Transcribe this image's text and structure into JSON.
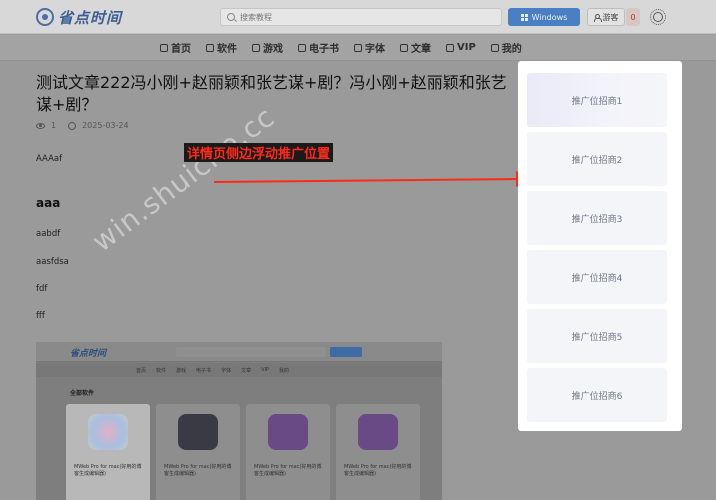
{
  "header": {
    "logo_text": "省点时间",
    "search_placeholder": "搜索教程",
    "windows_label": "Windows",
    "guest_label": "游客",
    "notification_count": "0"
  },
  "nav": {
    "items": [
      "首页",
      "软件",
      "游戏",
      "电子书",
      "字体",
      "文章",
      "VIP",
      "我的"
    ]
  },
  "article": {
    "title": "测试文章222冯小刚+赵丽颖和张艺谋+剧？冯小刚+赵丽颖和张艺谋+剧？",
    "views": "1",
    "date": "2025-03-24",
    "paragraphs": [
      "AAAaf",
      "aabdf",
      "aasfdsa",
      "fdf",
      "fff"
    ],
    "heading": "aaa"
  },
  "annotation": {
    "text": "详情页侧边浮动推广位置",
    "color": "#ff2a1a"
  },
  "watermark": "win.shuiche.cc",
  "embedded_screenshot": {
    "logo_text": "省点时间",
    "nav_items": [
      "首页",
      "软件",
      "游戏",
      "电子书",
      "字体",
      "文章",
      "VIP",
      "我的"
    ],
    "section_title": "全部软件",
    "cards": [
      "MWeb Pro for mac(好用的博客生成编辑器)",
      "MWeb Pro for mac(好用的博客生成编辑器)",
      "MWeb Pro for mac(好用的博客生成编辑器)",
      "MWeb Pro for mac(好用的博客生成编辑器)"
    ]
  },
  "sidebar": {
    "promos": [
      "推广位招商1",
      "推广位招商2",
      "推广位招商3",
      "推广位招商4",
      "推广位招商5",
      "推广位招商6"
    ]
  },
  "colors": {
    "accent": "#4b7fc4",
    "promo_text": "#6e7788",
    "annotation_red": "#ff2a1a"
  }
}
